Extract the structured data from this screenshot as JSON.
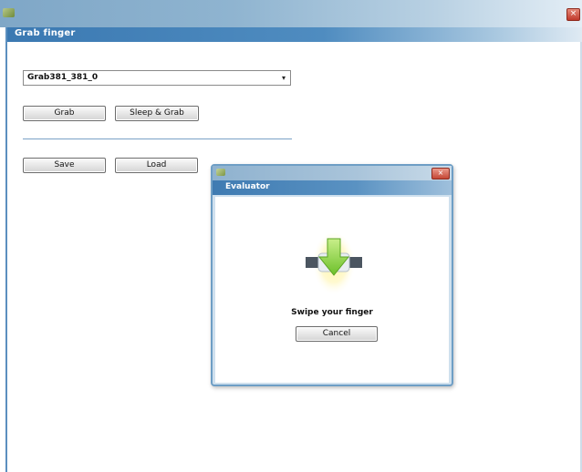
{
  "main_window": {
    "title": "Grab finger",
    "close_glyph": "×"
  },
  "combo": {
    "value": "Grab381_381_0",
    "arrow_glyph": "▾"
  },
  "buttons": {
    "grab": "Grab",
    "sleep_grab": "Sleep & Grab",
    "save": "Save",
    "load": "Load"
  },
  "evaluator": {
    "title": "Evaluator",
    "close_glyph": "×",
    "prompt": "Swipe your finger",
    "cancel": "Cancel",
    "graphic_icon": "finger-swipe-icon"
  },
  "colors": {
    "caption_blue": "#3b79b2",
    "accent_green": "#8fd14f",
    "close_red": "#c0392b"
  }
}
